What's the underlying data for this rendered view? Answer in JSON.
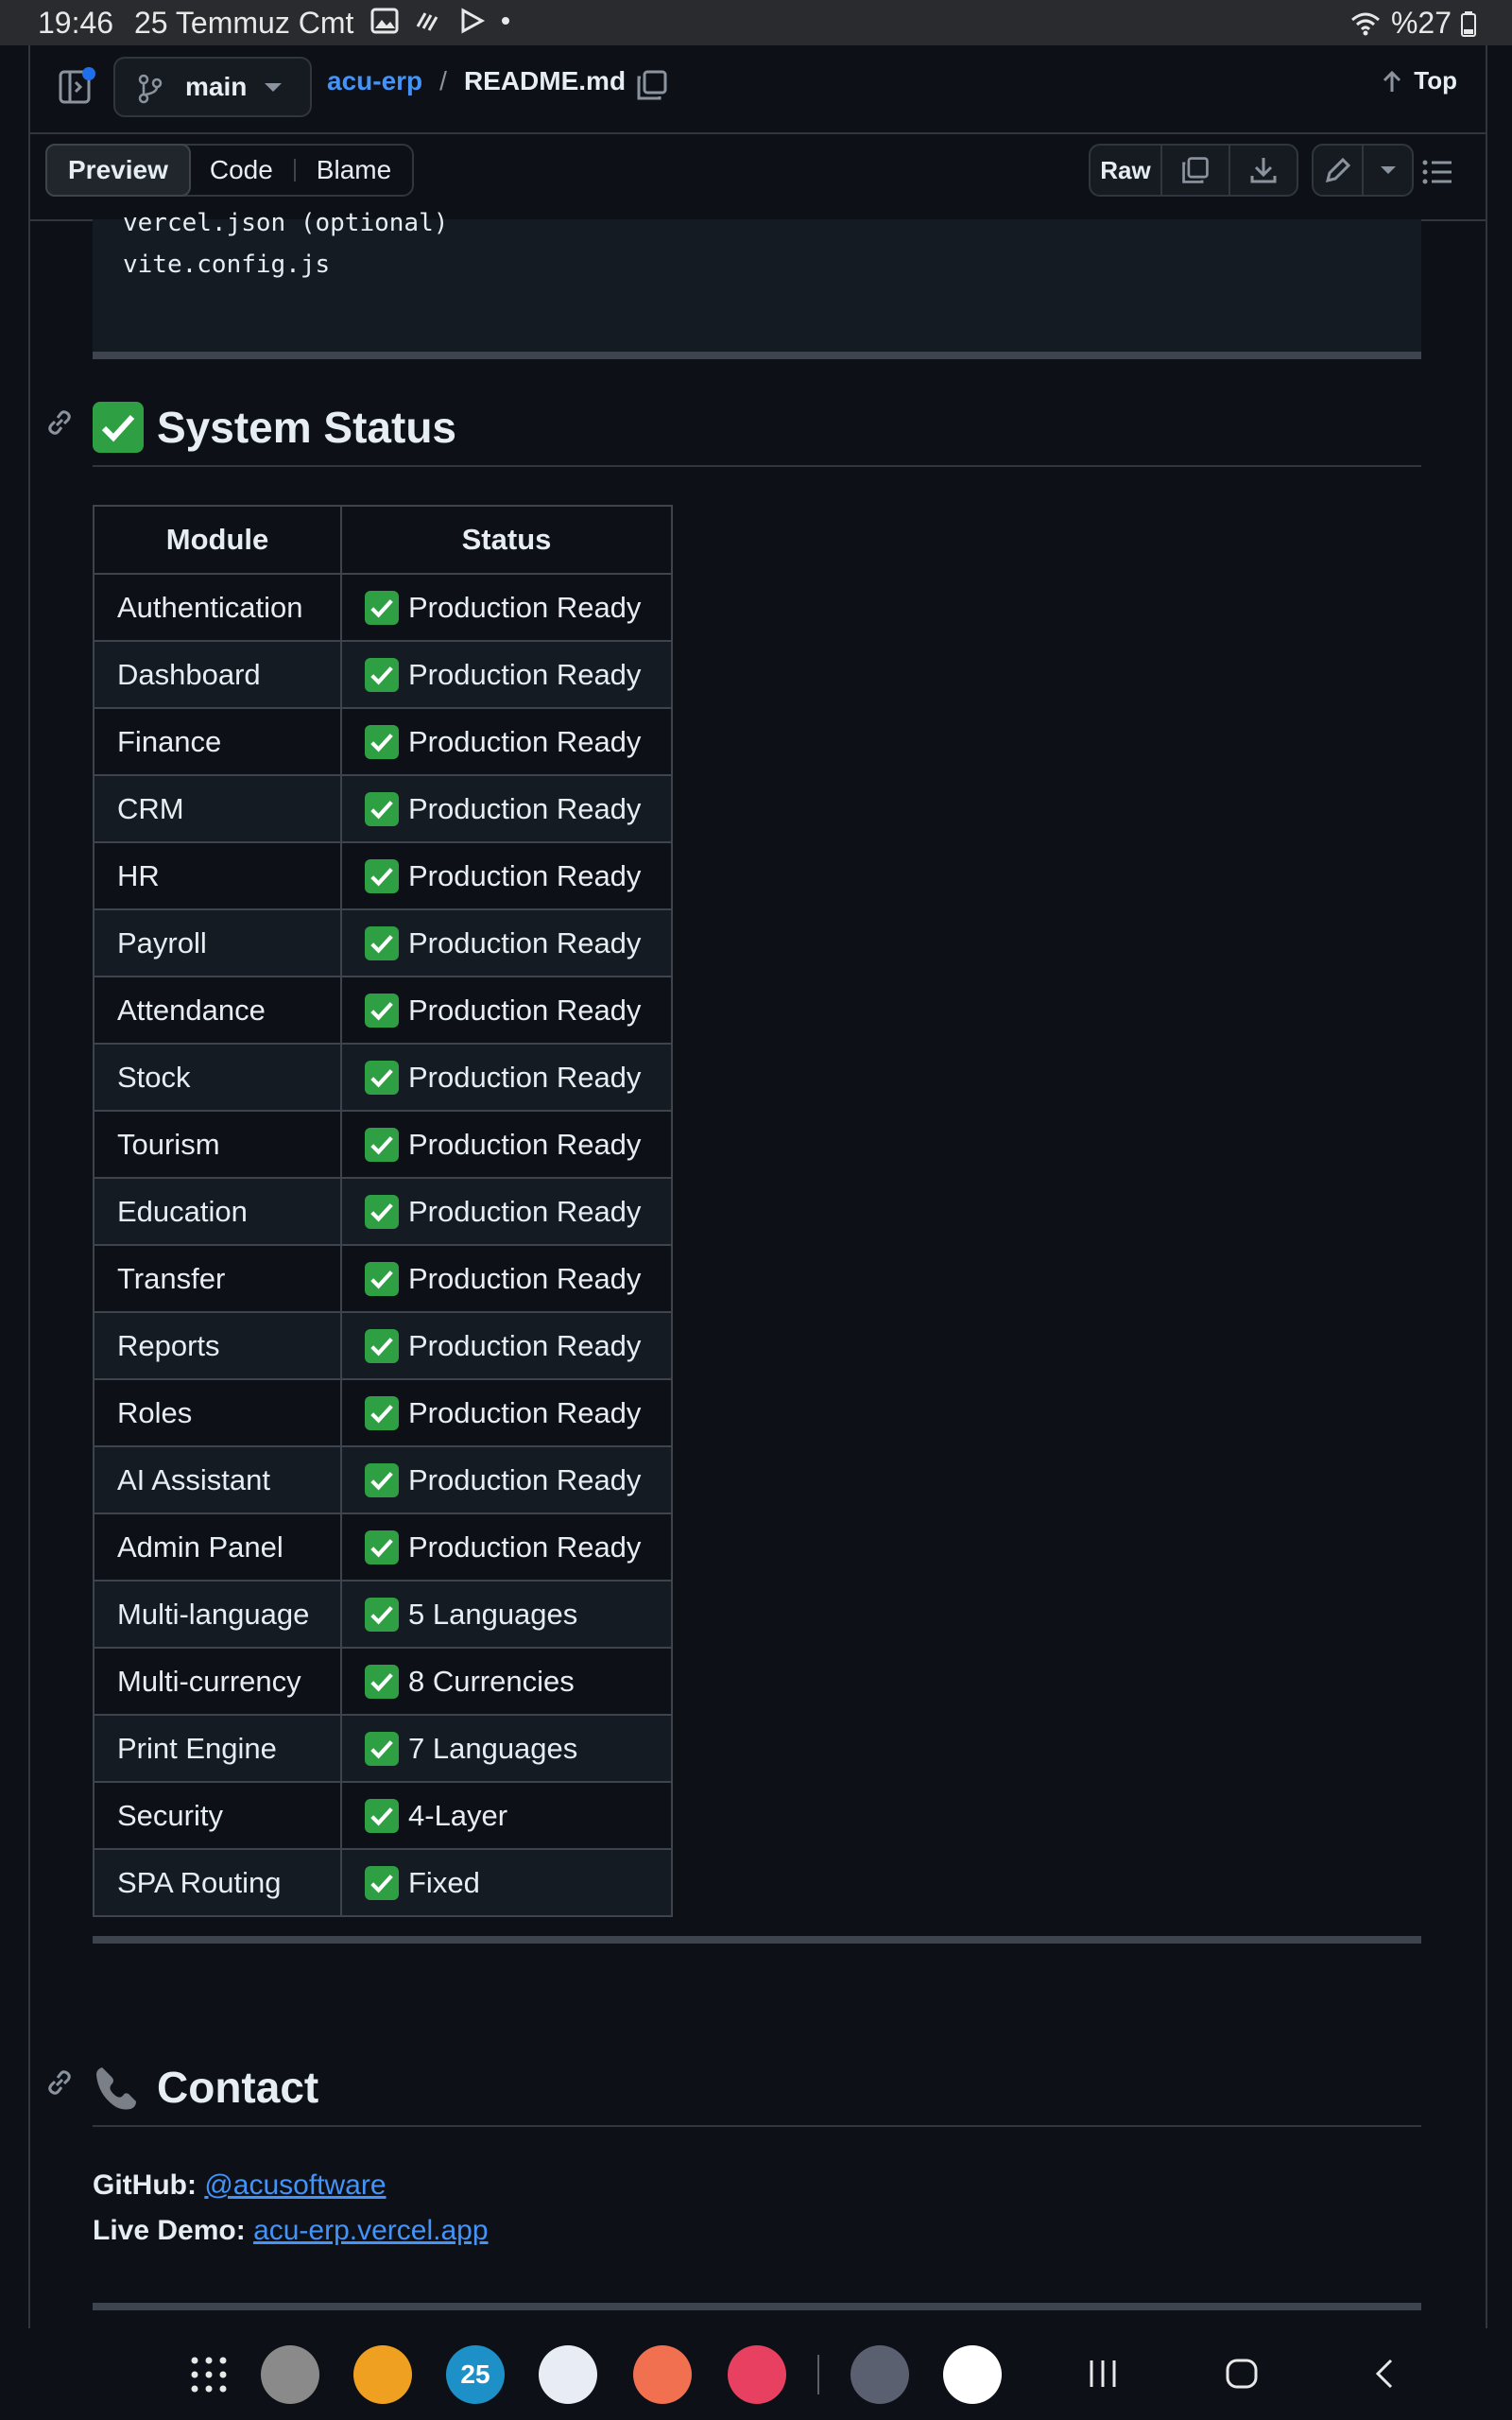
{
  "status_bar": {
    "time": "19:46",
    "date": "25 Temmuz Cmt",
    "battery": "%27"
  },
  "header": {
    "branch": "main",
    "repo": "acu-erp",
    "separator": "/",
    "file": "README.md",
    "top_label": "Top"
  },
  "toolbar": {
    "tabs": [
      "Preview",
      "Code",
      "Blame"
    ],
    "raw_label": "Raw"
  },
  "code_lines": [
    "vercel.json (optional)",
    "vite.config.js"
  ],
  "system_status": {
    "heading": "System Status",
    "columns": [
      "Module",
      "Status"
    ],
    "rows": [
      {
        "module": "Authentication",
        "status": "Production Ready"
      },
      {
        "module": "Dashboard",
        "status": "Production Ready"
      },
      {
        "module": "Finance",
        "status": "Production Ready"
      },
      {
        "module": "CRM",
        "status": "Production Ready"
      },
      {
        "module": "HR",
        "status": "Production Ready"
      },
      {
        "module": "Payroll",
        "status": "Production Ready"
      },
      {
        "module": "Attendance",
        "status": "Production Ready"
      },
      {
        "module": "Stock",
        "status": "Production Ready"
      },
      {
        "module": "Tourism",
        "status": "Production Ready"
      },
      {
        "module": "Education",
        "status": "Production Ready"
      },
      {
        "module": "Transfer",
        "status": "Production Ready"
      },
      {
        "module": "Reports",
        "status": "Production Ready"
      },
      {
        "module": "Roles",
        "status": "Production Ready"
      },
      {
        "module": "AI Assistant",
        "status": "Production Ready"
      },
      {
        "module": "Admin Panel",
        "status": "Production Ready"
      },
      {
        "module": "Multi-language",
        "status": "5 Languages"
      },
      {
        "module": "Multi-currency",
        "status": "8 Currencies"
      },
      {
        "module": "Print Engine",
        "status": "7 Languages"
      },
      {
        "module": "Security",
        "status": "4-Layer"
      },
      {
        "module": "SPA Routing",
        "status": "Fixed"
      }
    ]
  },
  "contact": {
    "heading": "Contact",
    "github_label": "GitHub:",
    "github_value": "@acusoftware",
    "demo_label": "Live Demo:",
    "demo_value": "acu-erp.vercel.app"
  },
  "dock_apps": [
    {
      "icon": "apps-grid-icon",
      "color": "#0d1117"
    },
    {
      "icon": "browser-icon",
      "color": "#8a8a8a"
    },
    {
      "icon": "folder-icon",
      "color": "#f0a020"
    },
    {
      "icon": "calendar-icon",
      "color": "#1e90c8",
      "text": "25"
    },
    {
      "icon": "messages-icon",
      "color": "#e8ecf4"
    },
    {
      "icon": "contacts-icon",
      "color": "#f07050"
    },
    {
      "icon": "camera-icon",
      "color": "#e84060"
    },
    {
      "icon": "calculator-icon",
      "color": "#5a6070"
    },
    {
      "icon": "gmail-icon",
      "color": "#ffffff"
    }
  ]
}
